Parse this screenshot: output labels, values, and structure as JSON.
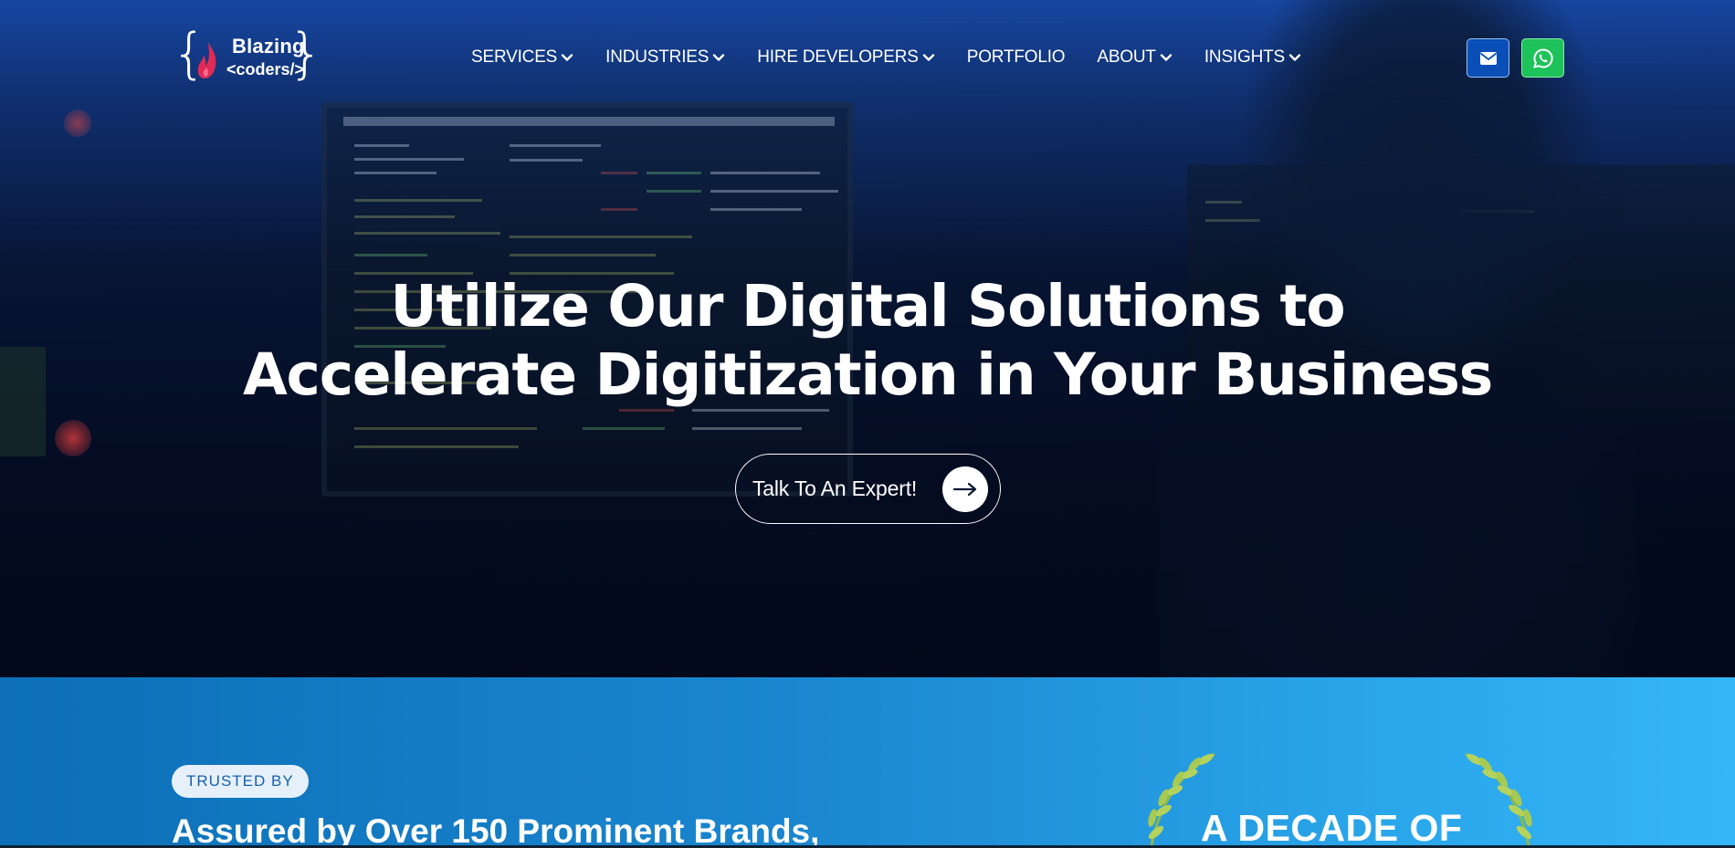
{
  "brand": {
    "logo_line1": "Blazing",
    "logo_line2": "<coders/>"
  },
  "nav": [
    {
      "label": "SERVICES",
      "dropdown": true
    },
    {
      "label": "INDUSTRIES",
      "dropdown": true
    },
    {
      "label": "HIRE DEVELOPERS",
      "dropdown": true
    },
    {
      "label": "PORTFOLIO",
      "dropdown": false
    },
    {
      "label": "ABOUT",
      "dropdown": true
    },
    {
      "label": "INSIGHTS",
      "dropdown": true
    }
  ],
  "header_actions": {
    "mail_icon": "envelope-icon",
    "whatsapp_icon": "whatsapp-icon"
  },
  "hero": {
    "title_line1": "Utilize Our Digital Solutions to",
    "title_line2": "Accelerate Digitization in Your Business",
    "cta_label": "Talk To An Expert!"
  },
  "trust": {
    "badge": "TRUSTED BY",
    "title": "Assured by Over 150 Prominent Brands,",
    "award_text": "A DECADE OF"
  },
  "colors": {
    "mail_button": "#0a4fb8",
    "whatsapp_button": "#1ec25a",
    "trust_gradient_start": "#0c6fb7",
    "trust_gradient_end": "#34b6f8",
    "badge_bg": "#e6f0fb",
    "badge_text": "#1661a8"
  }
}
